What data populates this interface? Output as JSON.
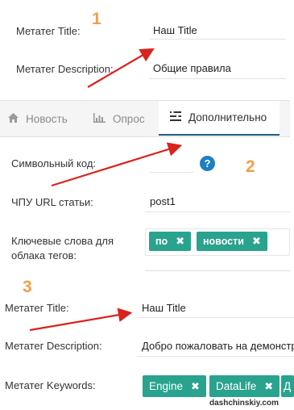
{
  "callouts": [
    "1",
    "2",
    "3"
  ],
  "section1": {
    "meta_title_label": "Метатег Title:",
    "meta_title_value": "Наш Title",
    "meta_desc_label": "Метатег Description:",
    "meta_desc_value": "Общие правила"
  },
  "tabs": [
    {
      "label": "Новость",
      "icon": "home-icon",
      "active": false
    },
    {
      "label": "Опрос",
      "icon": "bar-chart-icon",
      "active": false
    },
    {
      "label": "Дополнительно",
      "icon": "list-icon",
      "active": true
    }
  ],
  "section2": {
    "symbol_code_label": "Символьный код:",
    "symbol_code_value": "",
    "help_icon": "?",
    "url_label": "ЧПУ URL статьи:",
    "url_value": "post1",
    "keywords_label_line1": "Ключевые слова для",
    "keywords_label_line2": "облака тегов:",
    "keywords_tags": [
      "по",
      "новости"
    ]
  },
  "section3": {
    "meta_title_label": "Метатег Title:",
    "meta_title_value": "Наш Title",
    "meta_desc_label": "Метатег Description:",
    "meta_desc_value": "Добро пожаловать на демонстр",
    "meta_keywords_label": "Метатег Keywords:",
    "meta_keywords_tags": [
      "Engine",
      "DataLife",
      "Д"
    ]
  },
  "tag_remove_symbol": "✖",
  "watermark": "dashchinskiy.com",
  "colors": {
    "callout": "#f0a04b",
    "arrow": "#d9231e",
    "tag": "#29a38d",
    "help": "#1e7fc1",
    "active_tab_underline": "#1f5f86"
  }
}
